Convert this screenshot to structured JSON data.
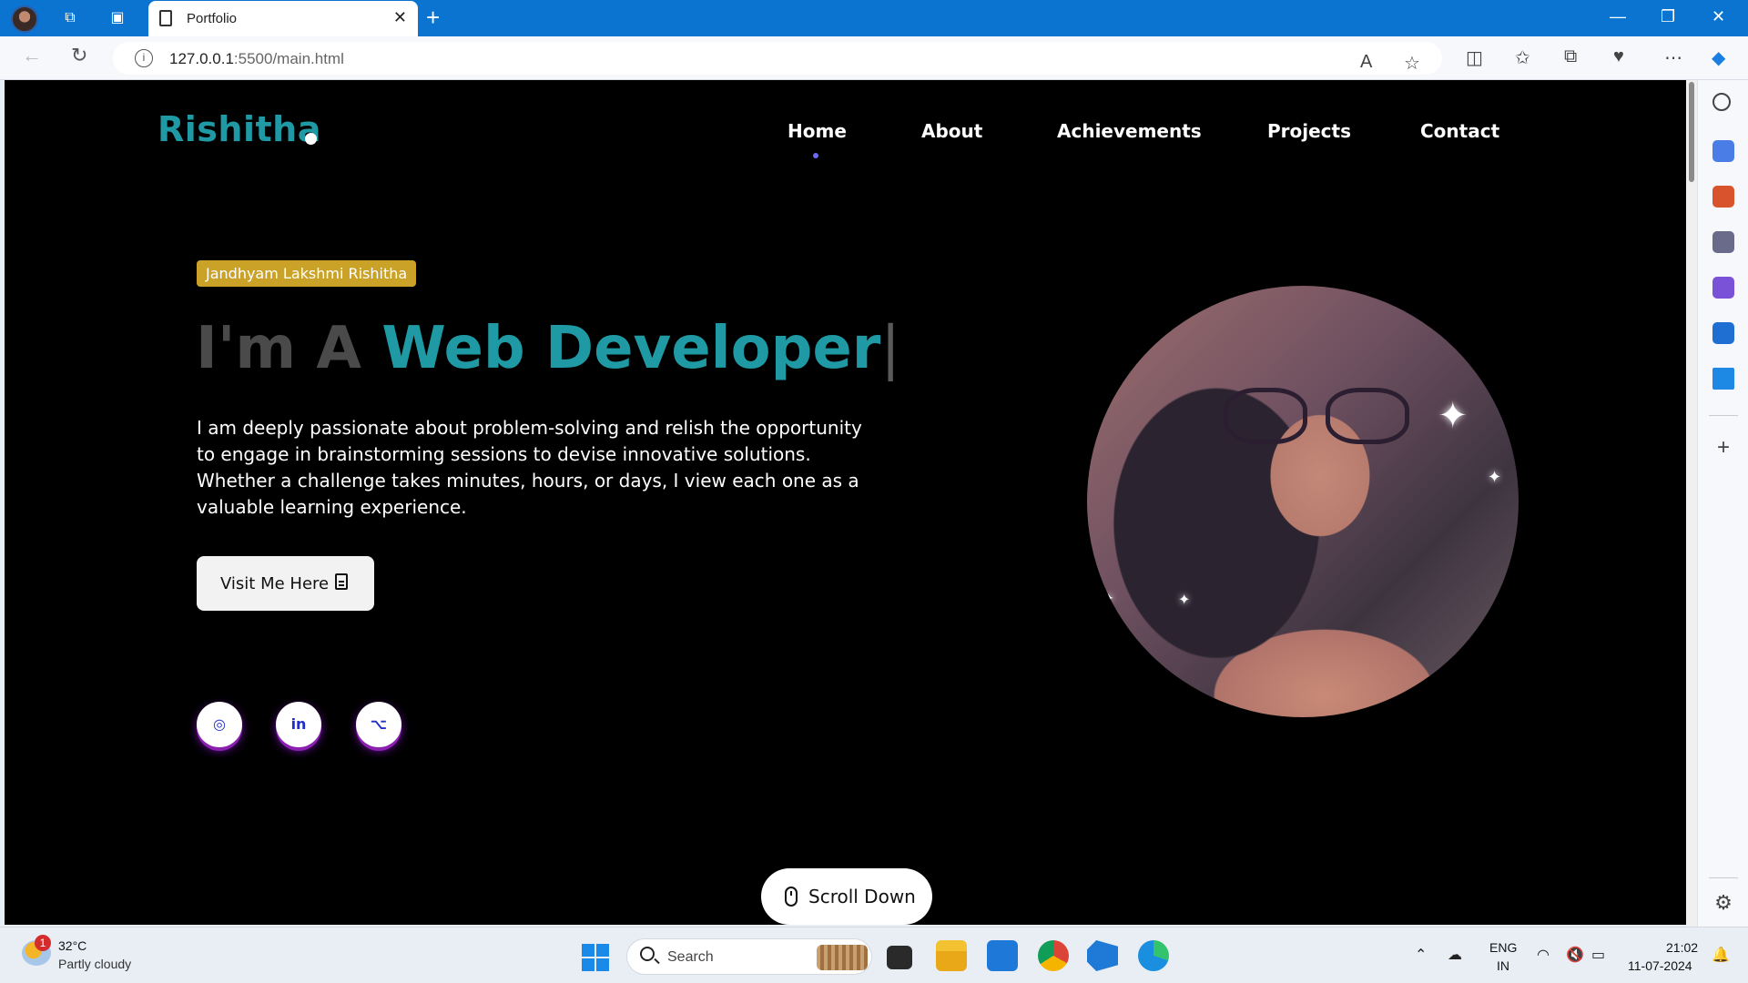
{
  "browser": {
    "tab_title": "Portfolio",
    "tab_close": "✕",
    "new_tab": "+",
    "url_host": "127.0.0.1",
    "url_path": ":5500/main.html",
    "window_controls": {
      "minimize": "—",
      "restore": "❐",
      "close": "✕"
    }
  },
  "site": {
    "logo": "Rishitha",
    "nav": [
      "Home",
      "About",
      "Achievements",
      "Projects",
      "Contact"
    ],
    "active_nav": "Home",
    "name_badge": "Jandhyam Lakshmi Rishitha",
    "headline_prefix": "I'm A",
    "headline_role": "Web Developer",
    "headline_cursor": "|",
    "bio": "I am deeply passionate about problem-solving and relish the opportunity to engage in brainstorming sessions to devise innovative solutions. Whether a challenge takes minutes, hours, or days, I view each one as a valuable learning experience.",
    "cta_label": "Visit Me Here",
    "social": [
      {
        "name": "instagram",
        "glyph": "◎"
      },
      {
        "name": "linkedin",
        "glyph": "in"
      },
      {
        "name": "github",
        "glyph": "⌥"
      }
    ],
    "scroll_label": "Scroll Down"
  },
  "taskbar": {
    "weather_temp": "32°C",
    "weather_desc": "Partly cloudy",
    "weather_badge": "1",
    "search_label": "Search",
    "lang_line1": "ENG",
    "lang_line2": "IN",
    "time": "21:02",
    "date": "11-07-2024"
  },
  "colors": {
    "accent_teal": "#1f9aa5",
    "badge_gold": "#c9a227",
    "titlebar_blue": "#0a74d0"
  }
}
